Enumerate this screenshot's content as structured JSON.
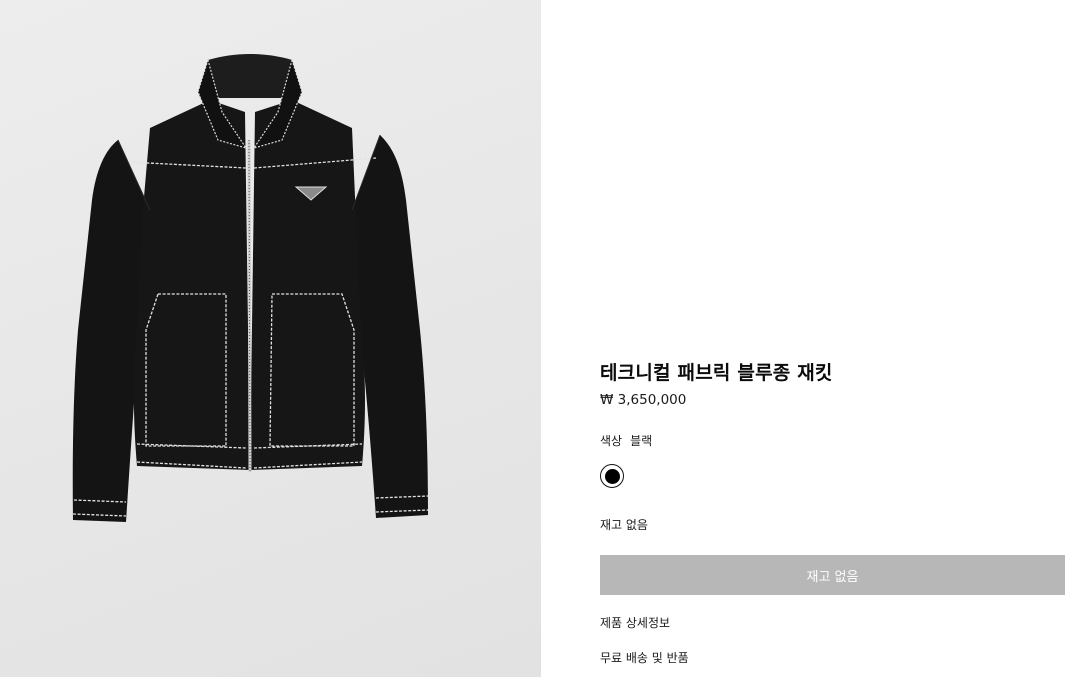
{
  "product": {
    "title": "테크니컬 패브릭 블루종 재킷",
    "price": "₩ 3,650,000",
    "color_label": "색상",
    "color_value": "블랙",
    "swatch_color": "#000000",
    "stock_status": "재고 없음",
    "cta_label": "재고 없음"
  },
  "links": {
    "details": "제품 상세정보",
    "shipping": "무료 배송 및 반품"
  },
  "colors": {
    "image_bg": "#e8e8e8",
    "jacket": "#121212",
    "stitch": "#e6e6e6",
    "button_disabled": "#b7b7b7"
  }
}
